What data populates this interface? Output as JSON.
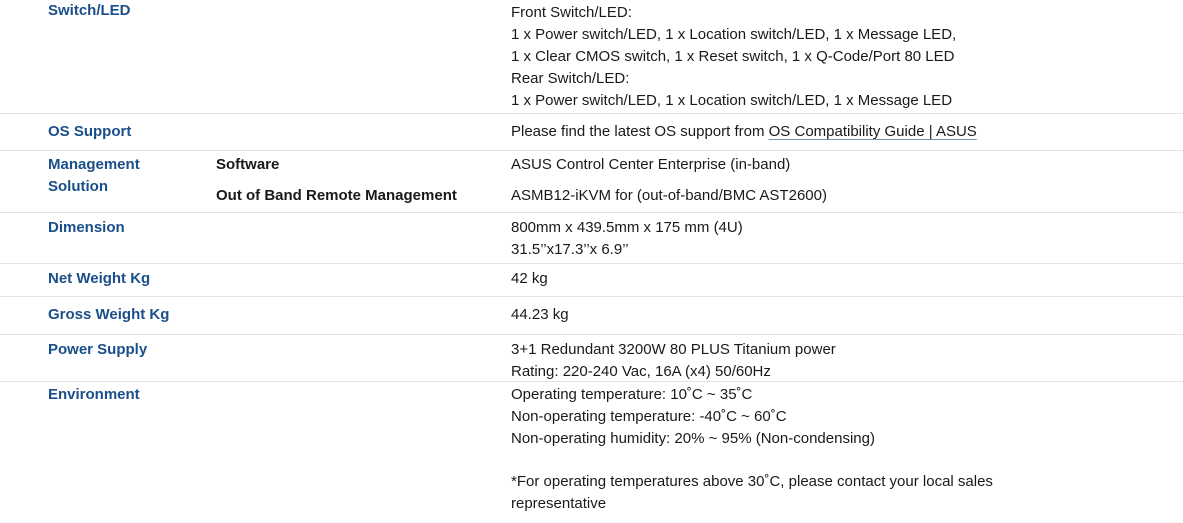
{
  "switch_led": {
    "label": "Switch/LED",
    "lines": [
      "Front Switch/LED:",
      "1 x Power switch/LED, 1 x Location switch/LED, 1 x Message LED,",
      "1 x Clear CMOS switch, 1 x Reset switch, 1 x Q-Code/Port 80 LED",
      "Rear Switch/LED:",
      "1 x Power switch/LED, 1 x Location switch/LED, 1 x Message LED"
    ]
  },
  "os_support": {
    "label": "OS Support",
    "prefix": "Please find the latest OS support from",
    "link": "OS Compatibility Guide | ASUS"
  },
  "management": {
    "label_line1": "Management",
    "label_line2": "Solution",
    "software_label": "Software",
    "software_value": "ASUS Control Center Enterprise (in-band)",
    "oob_label": "Out of Band Remote Management",
    "oob_value": "ASMB12-iKVM for (out-of-band/BMC AST2600)"
  },
  "dimension": {
    "label": "Dimension",
    "lines": [
      "800mm x 439.5mm x 175 mm (4U)",
      "31.5’’x17.3’’x 6.9’’"
    ]
  },
  "net_weight": {
    "label": "Net Weight Kg",
    "value": "42 kg"
  },
  "gross_weight": {
    "label": "Gross Weight Kg",
    "value": "44.23 kg"
  },
  "power_supply": {
    "label": "Power Supply",
    "lines": [
      "3+1 Redundant 3200W 80 PLUS Titanium power",
      "Rating: 220-240 Vac, 16A (x4) 50/60Hz"
    ]
  },
  "environment": {
    "label": "Environment",
    "lines": [
      "Operating temperature: 10˚C ~ 35˚C",
      "Non-operating temperature: -40˚C ~ 60˚C",
      "Non-operating humidity: 20% ~ 95% (Non-condensing)"
    ],
    "note_line1": "*For operating temperatures above 30˚C, please contact your local sales",
    "note_line2": "representative"
  }
}
